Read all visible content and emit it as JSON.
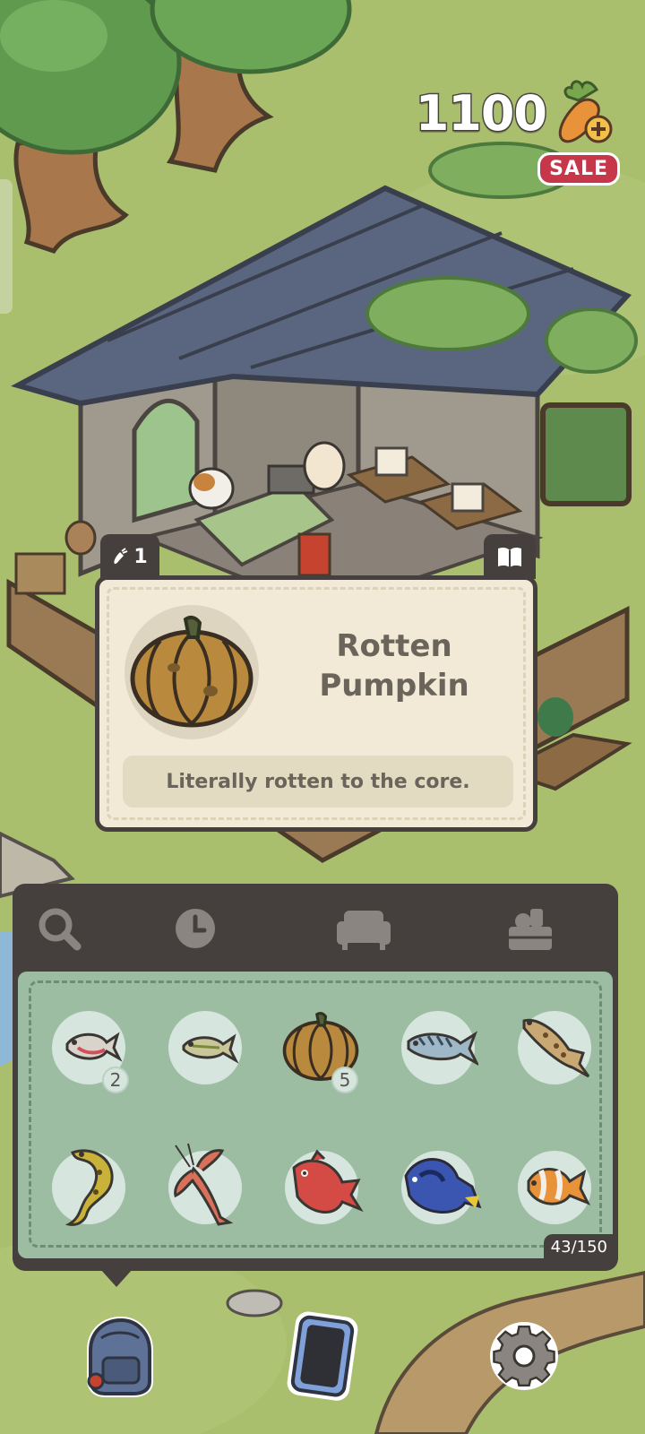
{
  "currency": {
    "amount": "1100",
    "icon": "carrot-plus-icon"
  },
  "sale_badge": "SALE",
  "item_card": {
    "carrot_count": "1",
    "title_line1": "Rotten",
    "title_line2": "Pumpkin",
    "description": "Literally rotten to the core.",
    "icon": "rotten-pumpkin-icon"
  },
  "inventory": {
    "tabs": [
      {
        "name": "search",
        "icon": "magnifier-icon"
      },
      {
        "name": "recent",
        "icon": "clock-icon"
      },
      {
        "name": "furniture",
        "icon": "sofa-icon"
      },
      {
        "name": "crafting",
        "icon": "crate-icon"
      }
    ],
    "items": [
      {
        "icon": "small-pink-fish-icon",
        "count": "2"
      },
      {
        "icon": "small-green-fish-icon",
        "count": ""
      },
      {
        "icon": "rotten-pumpkin-icon",
        "count": "5"
      },
      {
        "icon": "mackerel-icon",
        "count": ""
      },
      {
        "icon": "brown-trout-icon",
        "count": ""
      },
      {
        "icon": "moray-eel-icon",
        "count": ""
      },
      {
        "icon": "crayfish-icon",
        "count": ""
      },
      {
        "icon": "red-snapper-icon",
        "count": ""
      },
      {
        "icon": "blue-tang-icon",
        "count": ""
      },
      {
        "icon": "clownfish-icon",
        "count": ""
      }
    ],
    "capacity": "43/150"
  },
  "bottom_bar": [
    {
      "name": "backpack",
      "icon": "backpack-icon"
    },
    {
      "name": "phone",
      "icon": "phone-icon"
    },
    {
      "name": "settings",
      "icon": "gear-icon"
    }
  ],
  "colors": {
    "grass": "#a9bf6e",
    "panel_dark": "#45403d",
    "card_bg": "#f2ead6",
    "inventory_bg": "#9cbda2",
    "sale_red": "#c6374a",
    "roof": "#5a6680",
    "wood": "#8a6a45"
  }
}
